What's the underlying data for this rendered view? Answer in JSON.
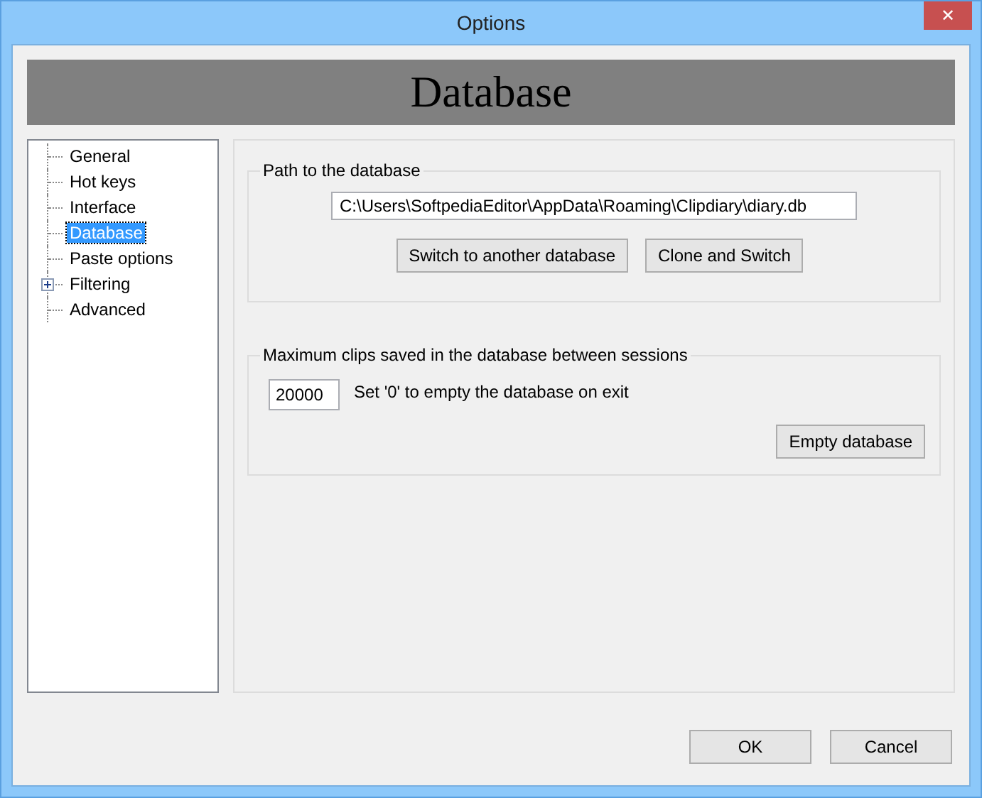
{
  "window": {
    "title": "Options",
    "close": "✕"
  },
  "header": {
    "title": "Database"
  },
  "tree": {
    "items": [
      {
        "label": "General",
        "kind": "leaf",
        "selected": false
      },
      {
        "label": "Hot keys",
        "kind": "leaf",
        "selected": false
      },
      {
        "label": "Interface",
        "kind": "leaf",
        "selected": false
      },
      {
        "label": "Database",
        "kind": "leaf",
        "selected": true
      },
      {
        "label": "Paste options",
        "kind": "leaf",
        "selected": false
      },
      {
        "label": "Filtering",
        "kind": "group",
        "selected": false
      },
      {
        "label": "Advanced",
        "kind": "leaf",
        "selected": false
      }
    ]
  },
  "path_group": {
    "legend": "Path to the database",
    "path": "C:\\Users\\SoftpediaEditor\\AppData\\Roaming\\Clipdiary\\diary.db",
    "buttons": [
      "Switch to another database",
      "Clone and Switch"
    ]
  },
  "clips_group": {
    "legend": "Maximum clips saved in the database between sessions",
    "value": "20000",
    "hint": "Set '0' to empty the database on exit",
    "button": "Empty database"
  },
  "buttons": [
    "OK",
    "Cancel"
  ]
}
